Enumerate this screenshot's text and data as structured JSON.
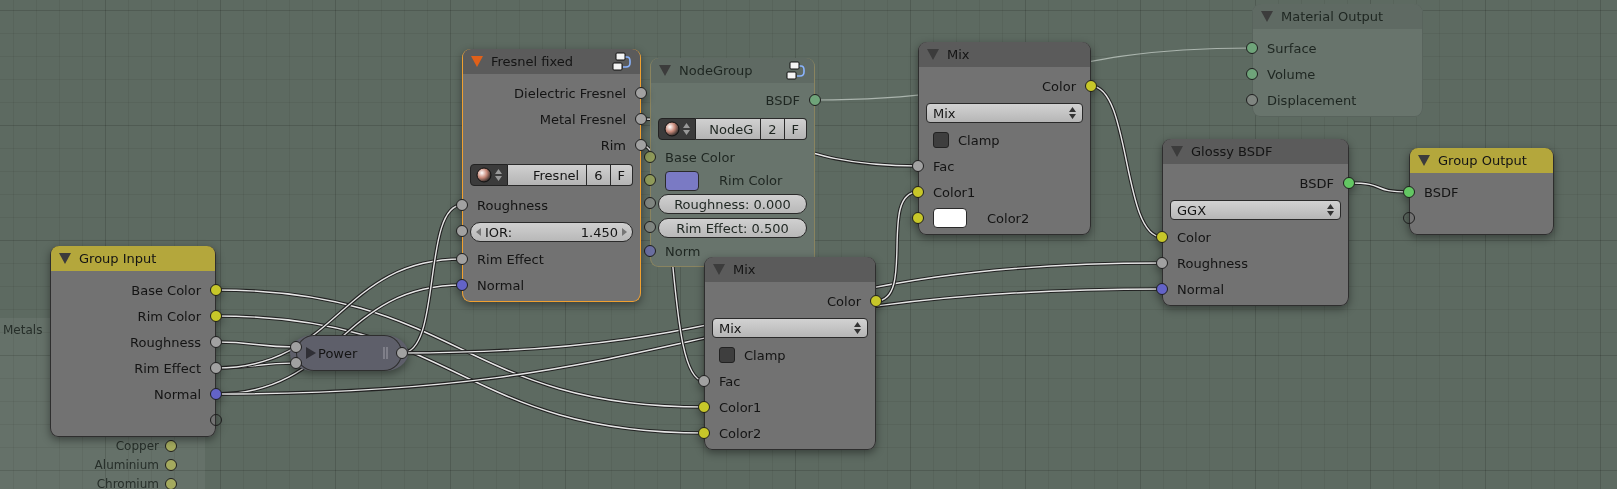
{
  "nodes": [
    {
      "kind": "frame",
      "title": "Metals",
      "dimmed": true,
      "rows": [
        {
          "kind": "output",
          "label": "Copper",
          "color": "#a4aa5e"
        },
        {
          "kind": "output",
          "label": "Aluminium",
          "color": "#a4aa5e"
        },
        {
          "kind": "output",
          "label": "Chromium",
          "color": "#a4aa5e"
        }
      ]
    },
    {
      "kind": "node",
      "title": "Group Input",
      "color": "#b4a73c",
      "dimmed": false,
      "selected": false,
      "rows": [
        {
          "kind": "output",
          "label": "Base Color",
          "color": "#c7c729"
        },
        {
          "kind": "output",
          "label": "Rim Color",
          "color": "#c7c729"
        },
        {
          "kind": "output",
          "label": "Roughness",
          "color": "#a1a1a1"
        },
        {
          "kind": "output",
          "label": "Rim Effect",
          "color": "#a1a1a1"
        },
        {
          "kind": "output",
          "label": "Normal",
          "color": "#6363c7"
        },
        {
          "kind": "empty-output"
        }
      ]
    },
    {
      "kind": "collapsed",
      "title": "Power",
      "color": "#5e5f6a",
      "inputs": [
        {
          "color": "#a1a1a1"
        },
        {
          "color": "#a1a1a1"
        }
      ],
      "outputs": [
        {
          "color": "#a1a1a1"
        }
      ]
    },
    {
      "kind": "group",
      "title": "Fresnel fixed",
      "color": "#5b5b5b",
      "dimmed": false,
      "selected": true,
      "rows": [
        {
          "kind": "output",
          "label": "Dielectric Fresnel",
          "color": "#a1a1a1"
        },
        {
          "kind": "output",
          "label": "Metal Fresnel",
          "color": "#a1a1a1"
        },
        {
          "kind": "output",
          "label": "Rim",
          "color": "#a1a1a1"
        },
        {
          "kind": "selector",
          "name": "Fresnel",
          "users": "6",
          "fake": "F"
        },
        {
          "kind": "input",
          "label": "Roughness",
          "color": "#a1a1a1"
        },
        {
          "kind": "field",
          "label": "IOR:",
          "value": "1.450",
          "color": "#a1a1a1"
        },
        {
          "kind": "input",
          "label": "Rim Effect",
          "color": "#a1a1a1"
        },
        {
          "kind": "input",
          "label": "Normal",
          "color": "#6363c7"
        }
      ]
    },
    {
      "kind": "group",
      "title": "NodeGroup",
      "color": "#5f6a63",
      "dimmed": true,
      "selected": true,
      "rows": [
        {
          "kind": "output",
          "label": "BSDF",
          "color": "#6fa47a"
        },
        {
          "kind": "selector",
          "name": "NodeG",
          "users": "2",
          "fake": "F"
        },
        {
          "kind": "input",
          "label": "Base Color",
          "color": "#8f9a5a"
        },
        {
          "kind": "color-input",
          "label": "Rim Color",
          "swatch": {
            "color": "#7a7ac4"
          },
          "color": "#8f9a5a"
        },
        {
          "kind": "value-field",
          "text": "Roughness: 0.000",
          "color": "#7f8580"
        },
        {
          "kind": "value-field",
          "text": "Rim Effect: 0.500",
          "color": "#7f8580"
        },
        {
          "kind": "input",
          "label": "Norm",
          "color": "#6a6ea0"
        }
      ]
    },
    {
      "kind": "node",
      "title": "Mix",
      "color": "#5b5b5b",
      "dimmed": false,
      "selected": false,
      "rows": [
        {
          "kind": "output",
          "label": "Color",
          "color": "#c7c729"
        },
        {
          "kind": "dropdown",
          "value": "Mix"
        },
        {
          "kind": "checkbox",
          "label": "Clamp",
          "checked": false
        },
        {
          "kind": "input",
          "label": "Fac",
          "color": "#a1a1a1"
        },
        {
          "kind": "input",
          "label": "Color1",
          "color": "#c7c729"
        },
        {
          "kind": "color-input",
          "label": "Color2",
          "swatch": {
            "color": "#ffffff"
          },
          "color": "#c7c729"
        }
      ]
    },
    {
      "kind": "node",
      "title": "Mix",
      "color": "#5b5b5b",
      "dimmed": false,
      "selected": false,
      "rows": [
        {
          "kind": "output",
          "label": "Color",
          "color": "#c7c729"
        },
        {
          "kind": "dropdown",
          "value": "Mix"
        },
        {
          "kind": "checkbox",
          "label": "Clamp",
          "checked": false
        },
        {
          "kind": "input",
          "label": "Fac",
          "color": "#a1a1a1"
        },
        {
          "kind": "input",
          "label": "Color1",
          "color": "#c7c729"
        },
        {
          "kind": "input",
          "label": "Color2",
          "color": "#c7c729"
        }
      ]
    },
    {
      "kind": "node",
      "title": "Material Output",
      "color": "#5f6a63",
      "dimmed": true,
      "selected": false,
      "rows": [
        {
          "kind": "input",
          "label": "Surface",
          "color": "#6fa47a"
        },
        {
          "kind": "input",
          "label": "Volume",
          "color": "#6fa47a"
        },
        {
          "kind": "input",
          "label": "Displacement",
          "color": "#7f8580"
        }
      ]
    },
    {
      "kind": "node",
      "title": "Glossy BSDF",
      "color": "#5b5b5b",
      "dimmed": false,
      "selected": false,
      "rows": [
        {
          "kind": "output",
          "label": "BSDF",
          "color": "#63c763"
        },
        {
          "kind": "dropdown",
          "value": "GGX"
        },
        {
          "kind": "input",
          "label": "Color",
          "color": "#c7c729"
        },
        {
          "kind": "input",
          "label": "Roughness",
          "color": "#a1a1a1"
        },
        {
          "kind": "input",
          "label": "Normal",
          "color": "#6363c7"
        }
      ]
    },
    {
      "kind": "node",
      "title": "Group Output",
      "color": "#b4a73c",
      "dimmed": false,
      "selected": false,
      "rows": [
        {
          "kind": "input",
          "label": "BSDF",
          "color": "#63c763"
        },
        {
          "kind": "empty-input"
        }
      ]
    }
  ]
}
